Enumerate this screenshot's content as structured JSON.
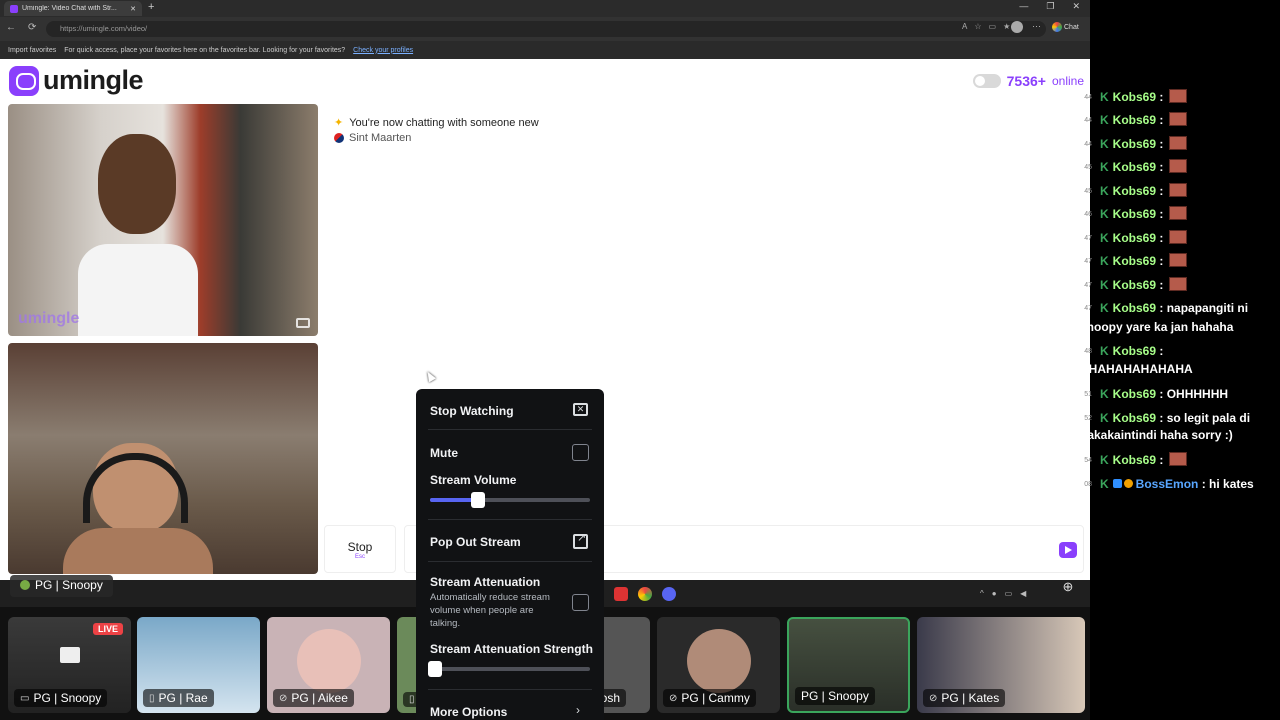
{
  "browser": {
    "tab_title": "Umingle: Video Chat with Str...",
    "new_tab": "+",
    "window_controls": [
      "—",
      "❐",
      "✕"
    ],
    "nav": [
      "←",
      "⟳"
    ],
    "url": "https://umingle.com/video/",
    "chat_label": "Chat",
    "favorites_import": "Import favorites",
    "favorites_hint": "For quick access, place your favorites here on the favorites bar. Looking for your favorites?",
    "favorites_link": "Check your profiles"
  },
  "site": {
    "logo": "umingle",
    "online_count": "7536+",
    "online_word": "online",
    "watermark": "umingle",
    "notice": "You're now chatting with someone new",
    "country": "Sint Maarten",
    "stop_label": "Stop",
    "stop_hint": "Esc"
  },
  "overlay_tag": "PG | Snoopy",
  "menu": {
    "stop_watching": "Stop Watching",
    "mute": "Mute",
    "stream_volume": "Stream Volume",
    "stream_volume_pct": 0.3,
    "pop_out": "Pop Out Stream",
    "attenuation": "Stream Attenuation",
    "attenuation_desc": "Automatically reduce stream volume when people are talking.",
    "attenuation_strength": "Stream Attenuation Strength",
    "attenuation_strength_pct": 0.03,
    "more_options": "More Options"
  },
  "tiles": [
    {
      "label": "PG | Snoopy",
      "live": "LIVE"
    },
    {
      "label": "PG | Rae"
    },
    {
      "label": "PG | Aikee"
    },
    {
      "label": "osh"
    },
    {
      "label": "PG | Cammy"
    },
    {
      "label": "PG | Snoopy"
    },
    {
      "label": "PG | Kates"
    }
  ],
  "chat": [
    {
      "ts": "44",
      "user": "Kobs69",
      "msg": ":",
      "emote": true
    },
    {
      "ts": "44",
      "user": "Kobs69",
      "msg": ":",
      "emote": true
    },
    {
      "ts": "44",
      "user": "Kobs69",
      "msg": ":",
      "emote": true
    },
    {
      "ts": "45",
      "user": "Kobs69",
      "msg": ":",
      "emote": true
    },
    {
      "ts": "45",
      "user": "Kobs69",
      "msg": ":",
      "emote": true
    },
    {
      "ts": "46",
      "user": "Kobs69",
      "msg": ":",
      "emote": true
    },
    {
      "ts": "47",
      "user": "Kobs69",
      "msg": ":",
      "emote": true
    },
    {
      "ts": "47",
      "user": "Kobs69",
      "msg": ":",
      "emote": true
    },
    {
      "ts": "47",
      "user": "Kobs69",
      "msg": ":",
      "emote": true
    },
    {
      "ts": "47",
      "user": "Kobs69",
      "msg": ": napapangiti ni",
      "cont": "snoopy yare ka jan hahaha"
    },
    {
      "ts": "48",
      "user": "Kobs69",
      "msg": ":",
      "cont": "HHAHAHAHAHAHA"
    },
    {
      "ts": "51",
      "user": "Kobs69",
      "msg": ": OHHHHHH"
    },
    {
      "ts": "52",
      "user": "Kobs69",
      "msg": ": so legit pala di",
      "cont": "nakakaintindi haha sorry :)"
    },
    {
      "ts": "54",
      "user": "Kobs69",
      "msg": ":",
      "emote": true
    },
    {
      "ts": "08",
      "user": "BossEmon",
      "msg": ": hi kates",
      "blue": true
    }
  ]
}
